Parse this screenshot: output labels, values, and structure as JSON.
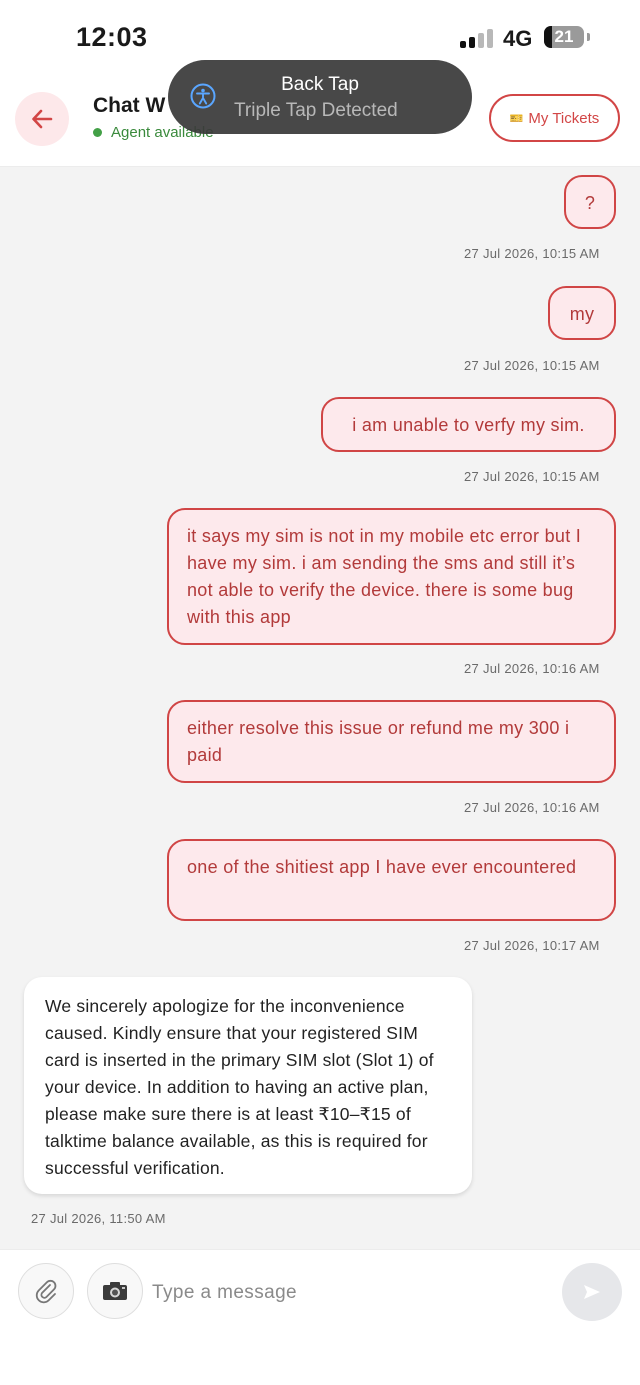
{
  "status_bar": {
    "time": "12:03",
    "network": "4G",
    "battery": "21"
  },
  "header": {
    "title": "Chat W",
    "status": "Agent available",
    "tickets_label": "My Tickets",
    "tickets_icon": "ticket-emoji",
    "back_icon": "arrow-left-icon",
    "accent": "#d24646"
  },
  "toast": {
    "title": "Back Tap",
    "subtitle": "Triple Tap Detected",
    "icon": "accessibility-icon"
  },
  "messages": [
    {
      "from": "user",
      "text": "?",
      "time": "27 Jul 2026, 10:15 AM"
    },
    {
      "from": "user",
      "text": "my",
      "time": "27 Jul 2026, 10:15 AM"
    },
    {
      "from": "user",
      "text": "i am unable to verfy my sim.",
      "time": "27 Jul 2026, 10:15 AM"
    },
    {
      "from": "user",
      "text": "it says my sim is not in my mobile etc error but I have my sim. i am sending the sms and still it’s not able to verify the device. there is some bug with this app",
      "time": "27 Jul 2026, 10:16 AM"
    },
    {
      "from": "user",
      "text": "either resolve this issue or refund me my 300 i paid",
      "time": "27 Jul 2026, 10:16 AM"
    },
    {
      "from": "user",
      "text": "one of the shitiest app I have ever encountered",
      "time": "27 Jul 2026, 10:17 AM"
    },
    {
      "from": "agent",
      "text": "We sincerely apologize for the inconvenience caused. Kindly ensure that your registered SIM card is inserted in the primary SIM slot (Slot 1) of your device. In addition to having an active plan, please make sure there is at least ₹10–₹15 of talktime balance available, as this is required for successful verification.",
      "time": "27 Jul 2026, 11:50 AM"
    }
  ],
  "composer": {
    "placeholder": "Type a message",
    "attach_icon": "paperclip-icon",
    "camera_icon": "camera-icon",
    "send_icon": "send-icon"
  }
}
